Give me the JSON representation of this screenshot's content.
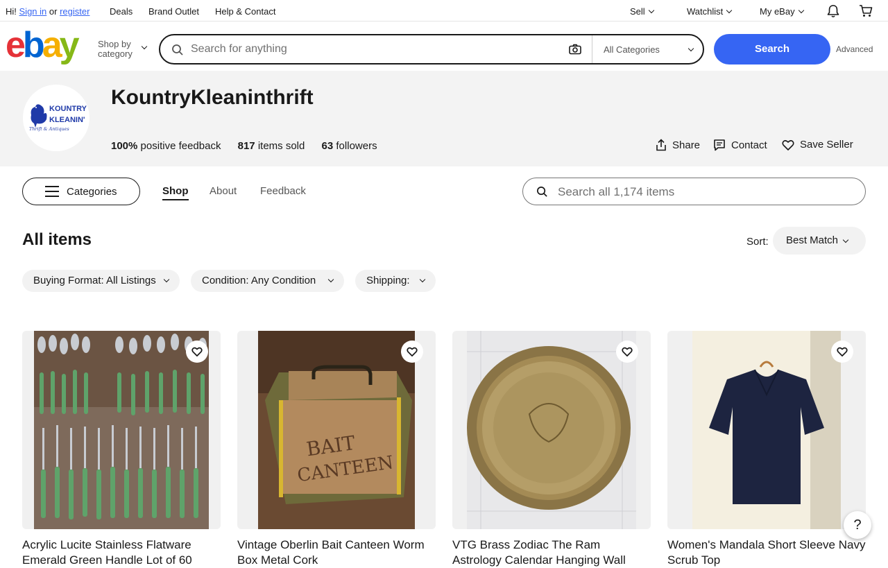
{
  "topbar": {
    "greeting": "Hi!",
    "sign_in": "Sign in",
    "or": "or",
    "register": "register",
    "deals": "Deals",
    "brand_outlet": "Brand Outlet",
    "help_contact": "Help & Contact",
    "sell": "Sell",
    "watchlist": "Watchlist",
    "my_ebay": "My eBay"
  },
  "header": {
    "shop_by_line1": "Shop by",
    "shop_by_line2": "category",
    "search_placeholder": "Search for anything",
    "category_select": "All Categories",
    "search_button": "Search",
    "advanced": "Advanced"
  },
  "store": {
    "name": "KountryKleaninthrift",
    "logo_text_1": "KOUNTRY",
    "logo_text_2": "KLEANIN'",
    "logo_text_3": "Thrift & Antiques",
    "feedback_value": "100%",
    "feedback_label": "positive feedback",
    "sold_value": "817",
    "sold_label": "items sold",
    "followers_value": "63",
    "followers_label": "followers",
    "share": "Share",
    "contact": "Contact",
    "save_seller": "Save Seller"
  },
  "nav": {
    "categories": "Categories",
    "tabs": [
      "Shop",
      "About",
      "Feedback"
    ],
    "search_placeholder": "Search all 1,174 items"
  },
  "listing": {
    "heading": "All items",
    "sort_label": "Sort:",
    "sort_value": "Best Match",
    "filters": [
      "Buying Format: All Listings",
      "Condition: Any Condition",
      "Shipping:"
    ]
  },
  "products": [
    {
      "title": "Acrylic Lucite Stainless Flatware Emerald Green Handle Lot of 60"
    },
    {
      "title": "Vintage Oberlin Bait Canteen Worm Box Metal Cork"
    },
    {
      "title": "VTG Brass Zodiac The Ram Astrology Calendar Hanging Wall Plate"
    },
    {
      "title": "Women's Mandala Short Sleeve Navy Scrub Top"
    }
  ],
  "help": "?",
  "colors": {
    "ebay_red": "#e53238",
    "ebay_blue": "#0064d2",
    "ebay_yellow": "#f5af02",
    "ebay_green": "#86b817",
    "primary_button": "#3665f3"
  }
}
